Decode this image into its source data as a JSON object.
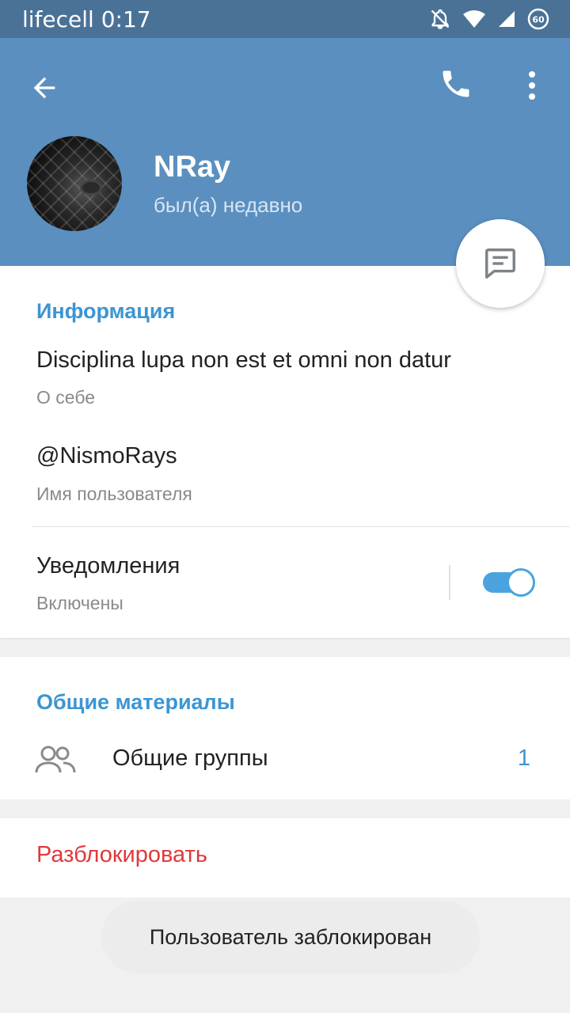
{
  "status_bar": {
    "carrier": "lifecell",
    "time": "0:17",
    "battery": "60"
  },
  "header": {
    "name": "NRay",
    "status": "был(а) недавно"
  },
  "colors": {
    "header": "#5b8fbf",
    "status_bar": "#4a7297",
    "accent": "#3d95d2",
    "danger": "#e0393b"
  },
  "info": {
    "title": "Информация",
    "bio": "Disciplina lupa non est et omni non datur",
    "bio_label": "О себе",
    "username": "@NismoRays",
    "username_label": "Имя пользователя",
    "notifications": "Уведомления",
    "notifications_state": "Включены",
    "notifications_on": true
  },
  "shared": {
    "title": "Общие материалы",
    "groups_label": "Общие группы",
    "groups_count": "1"
  },
  "actions": {
    "unblock": "Разблокировать"
  },
  "toast": "Пользователь заблокирован",
  "icons": [
    "back-arrow-icon",
    "phone-icon",
    "more-vert-icon",
    "message-icon",
    "groups-icon",
    "mute-icon",
    "wifi-icon",
    "signal-icon",
    "battery-icon"
  ]
}
